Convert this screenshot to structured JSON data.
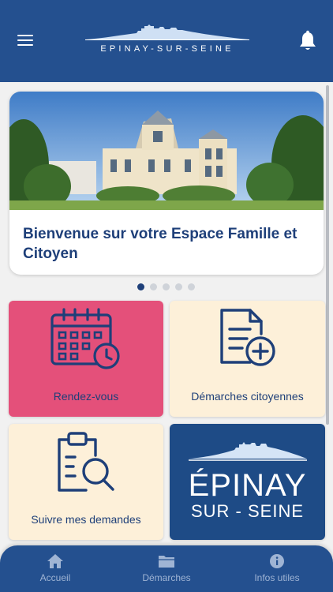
{
  "header": {
    "logo_text": "EPINAY-SUR-SEINE",
    "menu_icon": "hamburger-menu-icon",
    "notification_icon": "bell-icon"
  },
  "carousel": {
    "title": "Bienvenue sur votre Espace Famille et Citoyen",
    "slide_count": 5,
    "active_slide": 1
  },
  "tiles": [
    {
      "label": "Rendez-vous",
      "icon": "calendar-clock-icon",
      "bg": "#e4507a"
    },
    {
      "label": "Démarches citoyennes",
      "icon": "document-add-icon",
      "bg": "#fdf0d9"
    },
    {
      "label": "Suivre mes demandes",
      "icon": "clipboard-search-icon",
      "bg": "#fdf0d9"
    },
    {
      "brand_top": "ÉPINAY",
      "brand_bottom": "SUR - SEINE",
      "bg": "#1e4b86"
    }
  ],
  "bottom_nav": [
    {
      "label": "Accueil",
      "icon": "home-icon"
    },
    {
      "label": "Démarches",
      "icon": "folder-icon"
    },
    {
      "label": "Infos utiles",
      "icon": "info-icon"
    }
  ],
  "colors": {
    "primary": "#24508f",
    "title_text": "#1e3f79",
    "pink_tile": "#e4507a",
    "cream_tile": "#fdf0d9"
  }
}
